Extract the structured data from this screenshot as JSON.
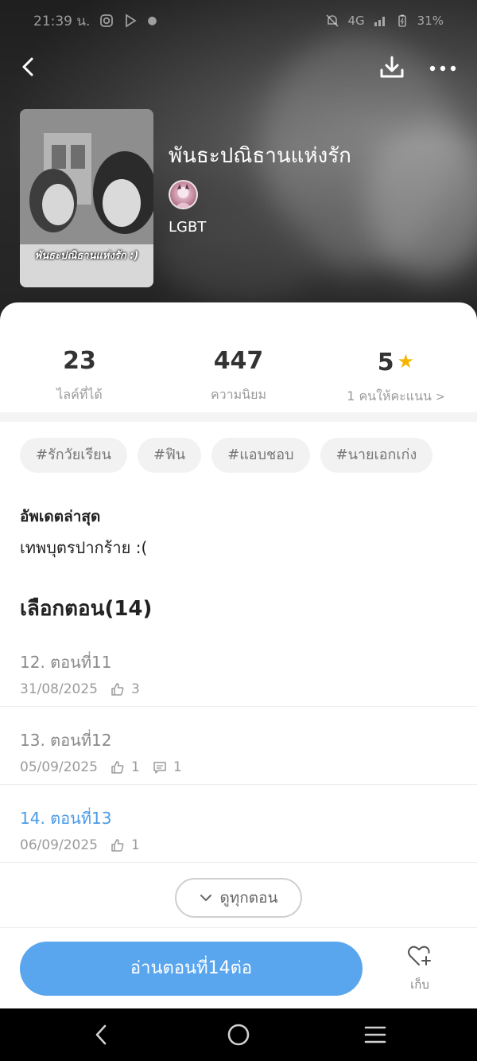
{
  "status_bar": {
    "time": "21:39 น.",
    "network": "4G",
    "battery": "31%"
  },
  "book": {
    "title": "พันธะปณิธานแห่งรัก",
    "cover_text": "พันธะปณิธานแห่งรัก :)",
    "genre": "LGBT"
  },
  "stats": {
    "likes_value": "23",
    "likes_label": "ไลค์ที่ได้",
    "popularity_value": "447",
    "popularity_label": "ความนิยม",
    "rating_value": "5",
    "rating_label": "1 คนให้คะแนน"
  },
  "tags": [
    "#รักวัยเรียน",
    "#ฟิน",
    "#แอบชอบ",
    "#นายเอกเก่ง"
  ],
  "latest": {
    "label": "อัพเดตล่าสุด",
    "text": "เทพบุตรปากร้าย :("
  },
  "chapters": {
    "heading": "เลือกตอน(14)",
    "items": [
      {
        "title": "12. ตอนที่11",
        "date": "31/08/2025",
        "likes": "3",
        "comments": ""
      },
      {
        "title": "13. ตอนที่12",
        "date": "05/09/2025",
        "likes": "1",
        "comments": "1"
      },
      {
        "title": "14. ตอนที่13",
        "date": "06/09/2025",
        "likes": "1",
        "comments": ""
      }
    ],
    "see_all": "ดูทุกตอน"
  },
  "actions": {
    "read_continue": "อ่านตอนที่14ต่อ",
    "keep": "เก็บ"
  },
  "colors": {
    "accent": "#5aa6ee",
    "active_chapter": "#4a9be8",
    "star": "#f5b400"
  }
}
